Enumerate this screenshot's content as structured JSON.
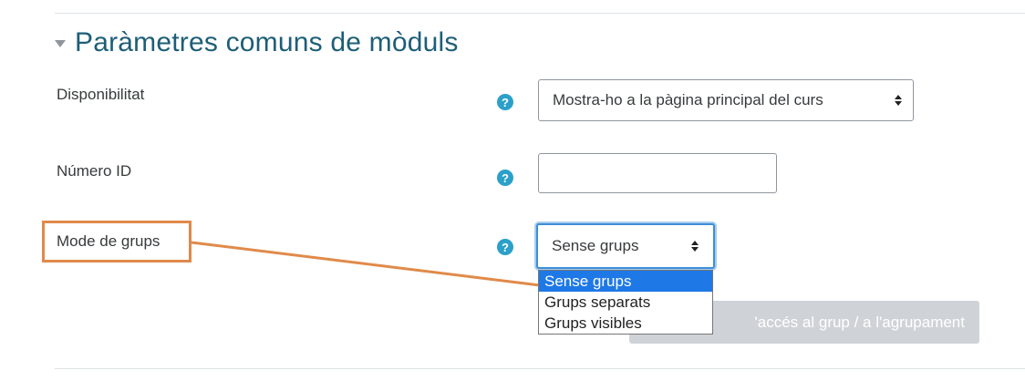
{
  "section": {
    "title": "Paràmetres comuns de mòduls",
    "collapse_icon": "caret-down-icon"
  },
  "fields": {
    "availability": {
      "label": "Disponibilitat",
      "help_glyph": "?",
      "value": "Mostra-ho a la pàgina principal del curs"
    },
    "id_number": {
      "label": "Número ID",
      "help_glyph": "?",
      "value": ""
    },
    "group_mode": {
      "label": "Mode de grups",
      "help_glyph": "?",
      "value": "Sense grups",
      "options": [
        "Sense grups",
        "Grups separats",
        "Grups visibles"
      ],
      "selected_index": 0
    }
  },
  "restrict_button": {
    "label": "'accés al grup / a l'agrupament"
  },
  "annotation": {
    "color": "#e08a4a"
  },
  "colors": {
    "title": "#1d5e78",
    "help": "#2ba0c9",
    "focus": "#3d8ed6",
    "option_selected": "#1e78e6"
  }
}
